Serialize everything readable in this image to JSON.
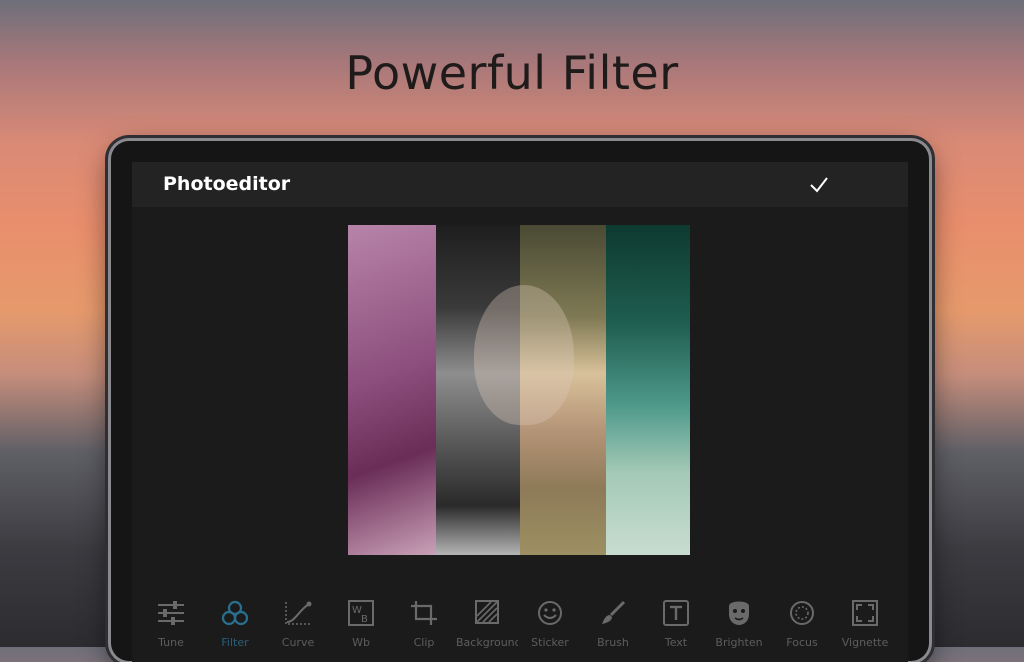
{
  "hero": {
    "title": "Powerful Filter"
  },
  "app": {
    "title": "Photoeditor"
  },
  "toolbar": {
    "items": [
      {
        "label": "Tune",
        "icon": "sliders-icon"
      },
      {
        "label": "Filter",
        "icon": "filter-circles-icon",
        "active": true
      },
      {
        "label": "Curve",
        "icon": "curve-icon"
      },
      {
        "label": "Wb",
        "icon": "white-balance-icon"
      },
      {
        "label": "Clip",
        "icon": "crop-icon"
      },
      {
        "label": "Background",
        "icon": "background-icon"
      },
      {
        "label": "Sticker",
        "icon": "smiley-icon"
      },
      {
        "label": "Brush",
        "icon": "brush-icon"
      },
      {
        "label": "Text",
        "icon": "text-box-icon"
      },
      {
        "label": "Brighten",
        "icon": "face-mask-icon"
      },
      {
        "label": "Focus",
        "icon": "focus-icon"
      },
      {
        "label": "Vignette",
        "icon": "vignette-icon"
      }
    ]
  },
  "colors": {
    "active": "#2a6f8f",
    "inactive": "#6a6a6a"
  }
}
